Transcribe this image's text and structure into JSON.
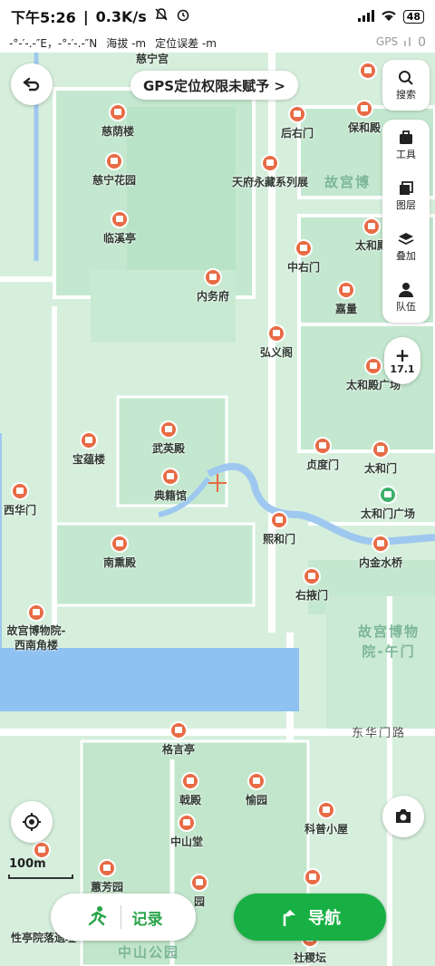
{
  "status_bar": {
    "time": "下午5:26",
    "speed": "0.3K/s",
    "battery": "48"
  },
  "info_bar": {
    "coords": "-°-′-.-″E，-°-′-.-″N",
    "altitude": "海拔 -m",
    "accuracy": "定位误差 -m",
    "gps_label": "GPS",
    "gps_count": "0"
  },
  "banner": {
    "text": "GPS定位权限未赋予 >"
  },
  "tools": [
    {
      "icon": "search-icon",
      "label": "搜索"
    },
    {
      "icon": "toolbox-icon",
      "label": "工具"
    },
    {
      "icon": "layers-icon",
      "label": "图层"
    },
    {
      "icon": "overlay-icon",
      "label": "叠加"
    },
    {
      "icon": "team-icon",
      "label": "队伍"
    }
  ],
  "zoom": {
    "plus": "+",
    "level": "17.1"
  },
  "scale": {
    "label": "100m"
  },
  "record": {
    "label": "记录"
  },
  "navigate": {
    "label": "导航"
  },
  "map": {
    "pois": [
      {
        "name": "慈宁宫"
      },
      {
        "name": "慈荫楼"
      },
      {
        "name": "慈宁花园"
      },
      {
        "name": "临溪亭"
      },
      {
        "name": "后右门"
      },
      {
        "name": "保和殿"
      },
      {
        "name": "天府永藏系列展"
      },
      {
        "name": "中右门"
      },
      {
        "name": "太和殿"
      },
      {
        "name": "内务府"
      },
      {
        "name": "嘉量"
      },
      {
        "name": "弘义阁"
      },
      {
        "name": "太和殿广场"
      },
      {
        "name": "武英殿"
      },
      {
        "name": "宝蕴楼"
      },
      {
        "name": "典籍馆"
      },
      {
        "name": "贞度门"
      },
      {
        "name": "太和门"
      },
      {
        "name": "西华门"
      },
      {
        "name": "太和门广场"
      },
      {
        "name": "熙和门"
      },
      {
        "name": "南熏殿"
      },
      {
        "name": "内金水桥"
      },
      {
        "name": "右掖门"
      },
      {
        "name": "故宫博物院-西南角楼"
      },
      {
        "name": "格言亭"
      },
      {
        "name": "戟殿"
      },
      {
        "name": "愉园"
      },
      {
        "name": "中山堂"
      },
      {
        "name": "科普小屋"
      },
      {
        "name": "蕙芳园"
      },
      {
        "name": "园"
      },
      {
        "name": "社稷坛"
      },
      {
        "name": "性亭院落遗址"
      }
    ],
    "areas": [
      {
        "name": "故宫博"
      },
      {
        "name": "故宫博物院-午门"
      },
      {
        "name": "中山公园"
      }
    ],
    "streets": [
      {
        "name": "东华门路"
      }
    ]
  }
}
